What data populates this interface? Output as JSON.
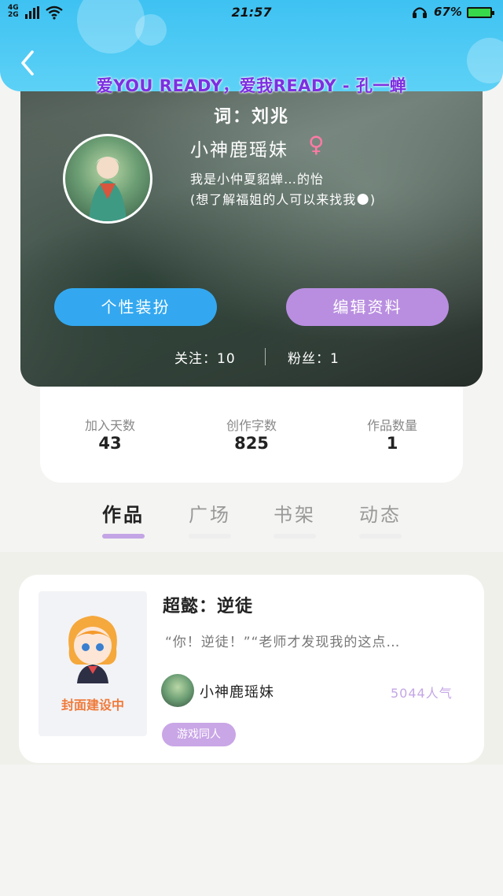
{
  "status_bar": {
    "signal_top": "4G",
    "signal_bottom": "2G",
    "time": "21:57",
    "battery": "67%"
  },
  "header": {
    "lyric_line": "爱YOU READY，爱我READY - 孔一蝉",
    "lyric_credit": "词：刘兆"
  },
  "profile": {
    "username": "小神鹿瑶妹",
    "gender_symbol": "♀",
    "bio_line1": "我是小仲夏貂蝉…的怡",
    "bio_line2": "(想了解福姐的人可以来找我🌑)",
    "buttons": {
      "dress_up": "个性装扮",
      "edit_profile": "编辑资料"
    },
    "follow": "关注：10",
    "fans": "粉丝：1"
  },
  "stats": [
    {
      "label": "加入天数",
      "value": "43"
    },
    {
      "label": "创作字数",
      "value": "825"
    },
    {
      "label": "作品数量",
      "value": "1"
    }
  ],
  "tabs": [
    {
      "label": "作品",
      "active": true
    },
    {
      "label": "广场",
      "active": false
    },
    {
      "label": "书架",
      "active": false
    },
    {
      "label": "动态",
      "active": false
    }
  ],
  "works": [
    {
      "cover_text": "封面建设中",
      "title": "超懿：逆徒",
      "excerpt": "“你！逆徒！”“老师才发现我的这点…",
      "author": "小神鹿瑶妹",
      "popularity": "5044人气",
      "tag": "游戏同人"
    }
  ],
  "colors": {
    "topbar": "#3ec2f2",
    "blue_button": "#33a8f0",
    "purple_button": "#b98ee0",
    "tab_indicator": "#c3a5e6",
    "lyric": "#7d2fe0",
    "cover_text": "#f07a3a",
    "popularity": "#c4a6e6"
  },
  "icons": [
    "back-arrow-icon",
    "wifi-icon",
    "headset-icon",
    "battery-icon",
    "female-icon"
  ]
}
